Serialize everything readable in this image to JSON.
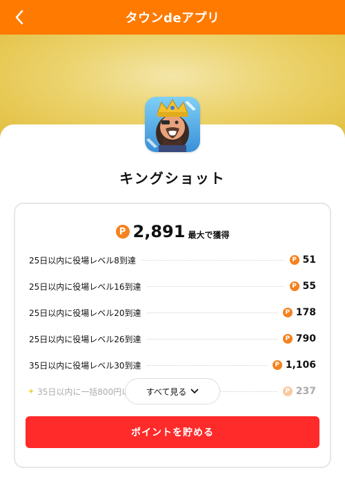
{
  "header": {
    "title": "タウンdeアプリ",
    "back_icon": "chevron-left-icon",
    "background_color": "#ff7a00"
  },
  "app": {
    "name": "キングショット",
    "icon": "king-character-app-icon"
  },
  "points": {
    "total": "2,891",
    "total_suffix": "最大で獲得",
    "coin_icon": "p-coin-icon",
    "coin_color": "#f5821f"
  },
  "tasks": [
    {
      "label": "25日以内に役場レベル8到達",
      "points": "51"
    },
    {
      "label": "25日以内に役場レベル16到達",
      "points": "55"
    },
    {
      "label": "25日以内に役場レベル20到達",
      "points": "178"
    },
    {
      "label": "25日以内に役場レベル26到達",
      "points": "790"
    },
    {
      "label": "35日以内に役場レベル30到達",
      "points": "1,106"
    },
    {
      "label": "35日以内に一括800円以",
      "points": "237",
      "faded": true,
      "icon": "sparkle-icon"
    }
  ],
  "see_all": {
    "label": "すべて見る",
    "icon": "chevron-down-icon"
  },
  "save_button": {
    "label": "ポイントを貯める",
    "color": "#ff2a2a"
  }
}
